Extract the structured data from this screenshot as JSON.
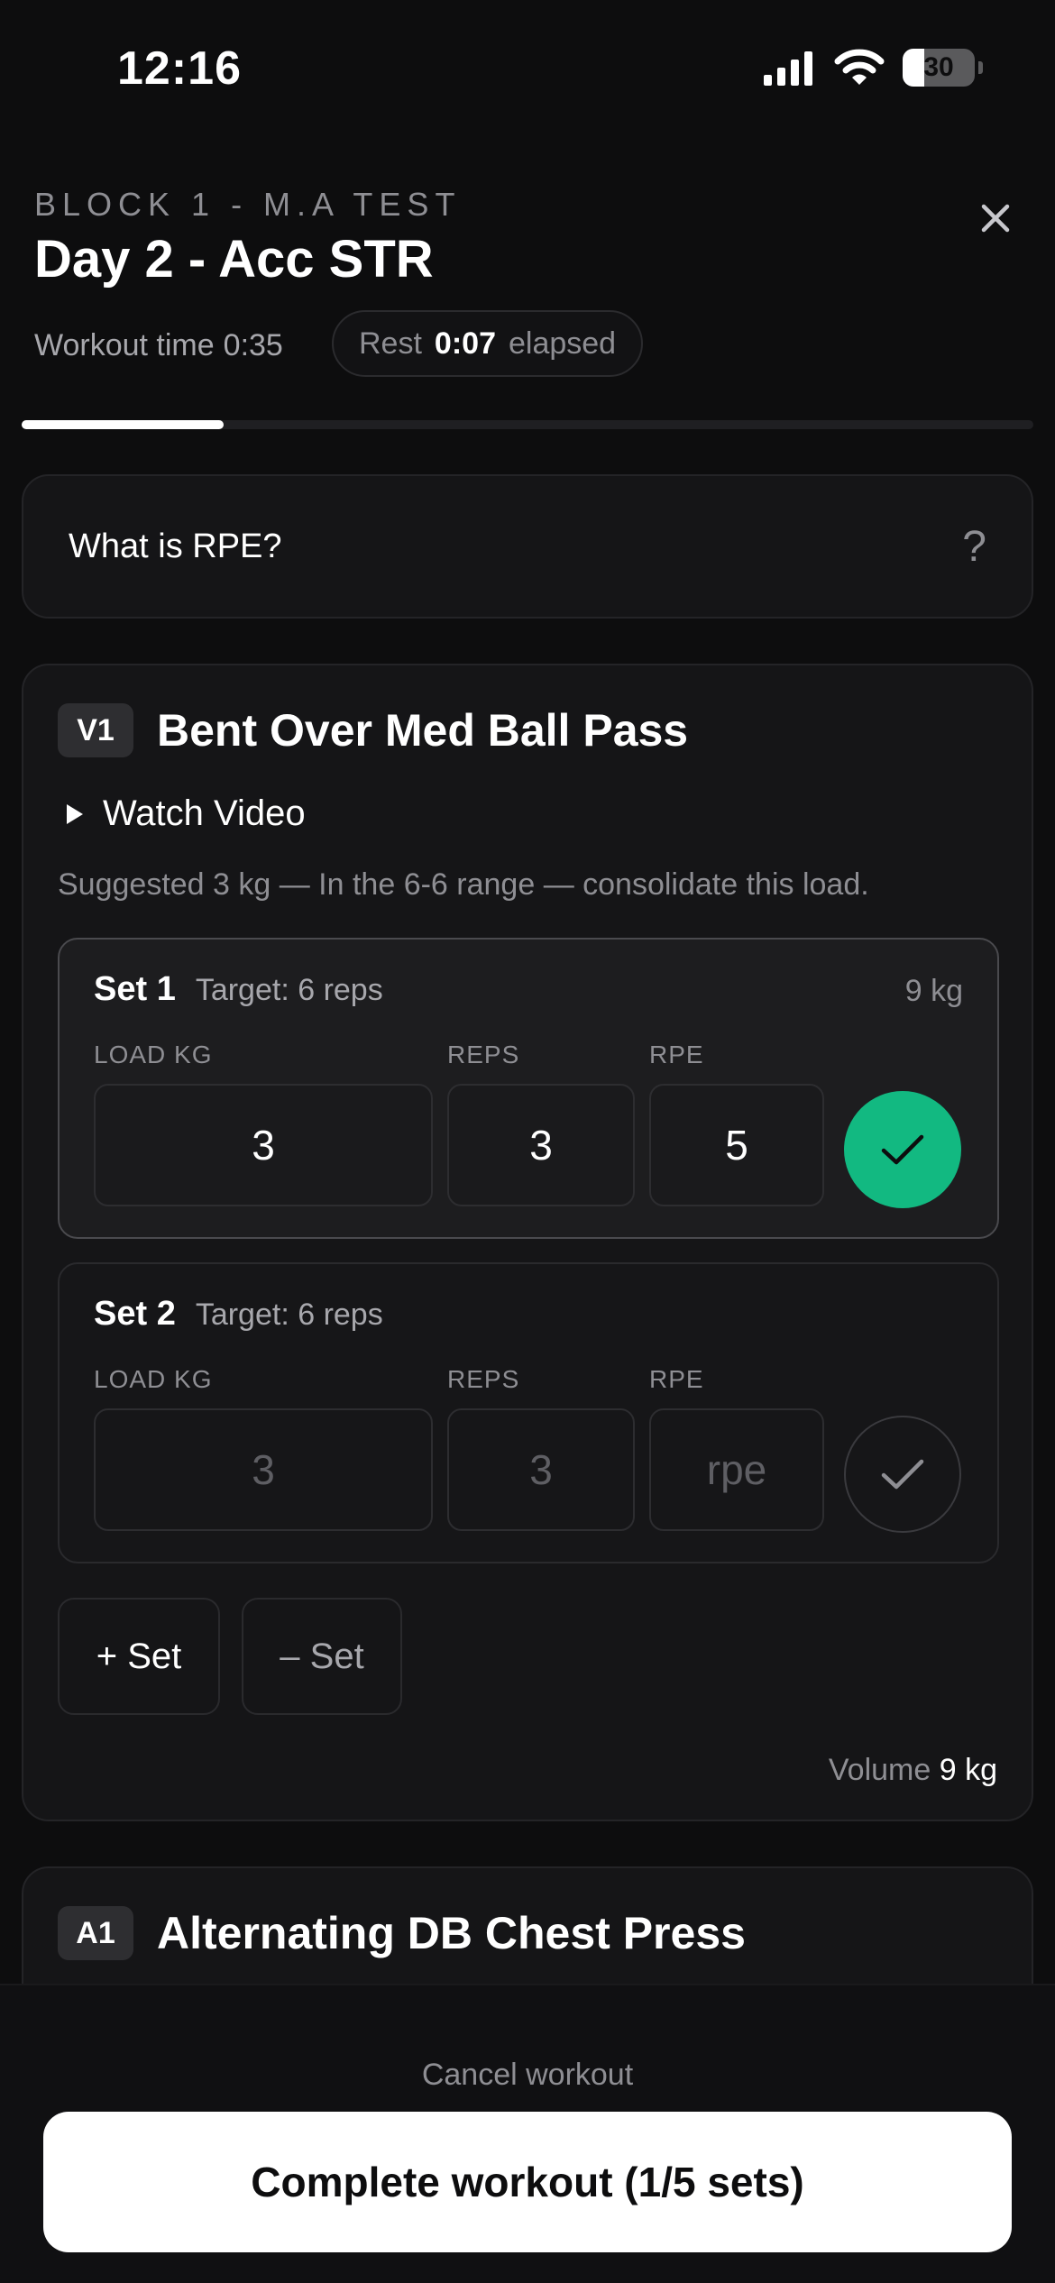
{
  "status_bar": {
    "time": "12:16",
    "battery": "30",
    "battery_level": 0.3
  },
  "header": {
    "block_label": "BLOCK 1 - M.A TEST",
    "title": "Day 2 - Acc STR",
    "workout_time_label": "Workout time",
    "workout_time_value": "0:35",
    "rest_label": "Rest",
    "rest_value": "0:07",
    "rest_suffix": "elapsed",
    "progress": 0.2
  },
  "rpe_info": {
    "label": "What is RPE?",
    "icon": "?"
  },
  "exercises": [
    {
      "badge": "V1",
      "name": "Bent Over Med Ball Pass",
      "watch_video_label": "Watch Video",
      "suggestion": "Suggested 3 kg — In the 6-6 range — consolidate this load.",
      "field_labels": {
        "load": "LOAD KG",
        "reps": "REPS",
        "rpe": "RPE"
      },
      "sets": [
        {
          "title": "Set 1",
          "target": "Target: 6 reps",
          "total": "9 kg",
          "load": "3",
          "reps": "3",
          "rpe": "5",
          "completed": true
        },
        {
          "title": "Set 2",
          "target": "Target: 6 reps",
          "load_placeholder": "3",
          "reps_placeholder": "3",
          "rpe_placeholder": "rpe",
          "completed": false
        }
      ],
      "add_set_label": "+ Set",
      "remove_set_label": "– Set",
      "volume_label": "Volume",
      "volume_value": "9 kg"
    },
    {
      "badge": "A1",
      "name": "Alternating DB Chest Press"
    }
  ],
  "footer": {
    "cancel_label": "Cancel workout",
    "complete_label": "Complete workout (1/5 sets)"
  },
  "colors": {
    "accent_green": "#12b981",
    "background": "#0d0d0e",
    "card": "#151517"
  }
}
